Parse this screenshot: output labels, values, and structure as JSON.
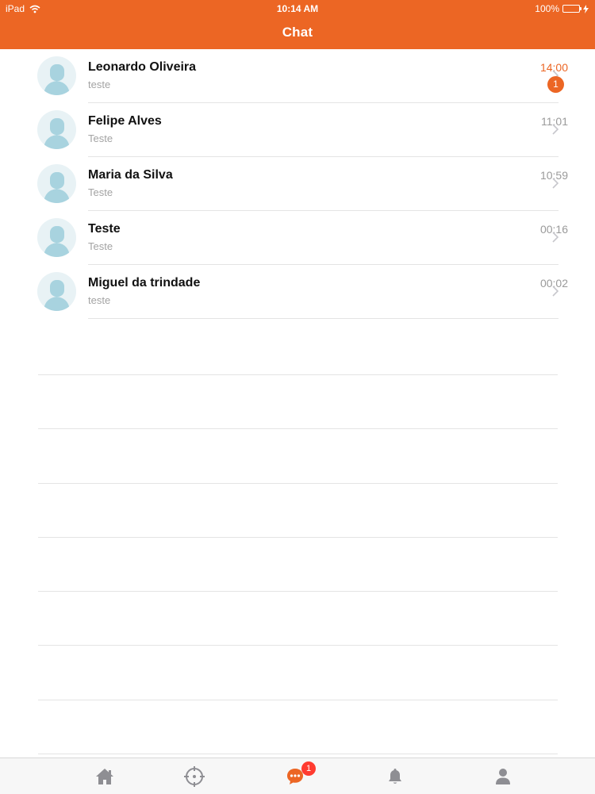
{
  "status_bar": {
    "device": "iPad",
    "time": "10:14 AM",
    "battery": "100%"
  },
  "header": {
    "title": "Chat"
  },
  "chats": [
    {
      "name": "Leonardo Oliveira",
      "preview": "teste",
      "time": "14:00",
      "unread": "1"
    },
    {
      "name": "Felipe Alves",
      "preview": "Teste",
      "time": "11:01"
    },
    {
      "name": "Maria da Silva",
      "preview": "Teste",
      "time": "10:59"
    },
    {
      "name": "Teste",
      "preview": "Teste",
      "time": "00:16"
    },
    {
      "name": "Miguel da trindade",
      "preview": "teste",
      "time": "00:02"
    }
  ],
  "tabbar": {
    "tabs": [
      {
        "icon": "home-icon"
      },
      {
        "icon": "crosshair-icon"
      },
      {
        "icon": "chat-icon",
        "badge": "1",
        "active": true
      },
      {
        "icon": "bell-icon"
      },
      {
        "icon": "person-icon"
      }
    ]
  },
  "colors": {
    "accent": "#ec6624",
    "badge_red": "#ff3b30",
    "inactive_icon": "#8e8e93"
  }
}
